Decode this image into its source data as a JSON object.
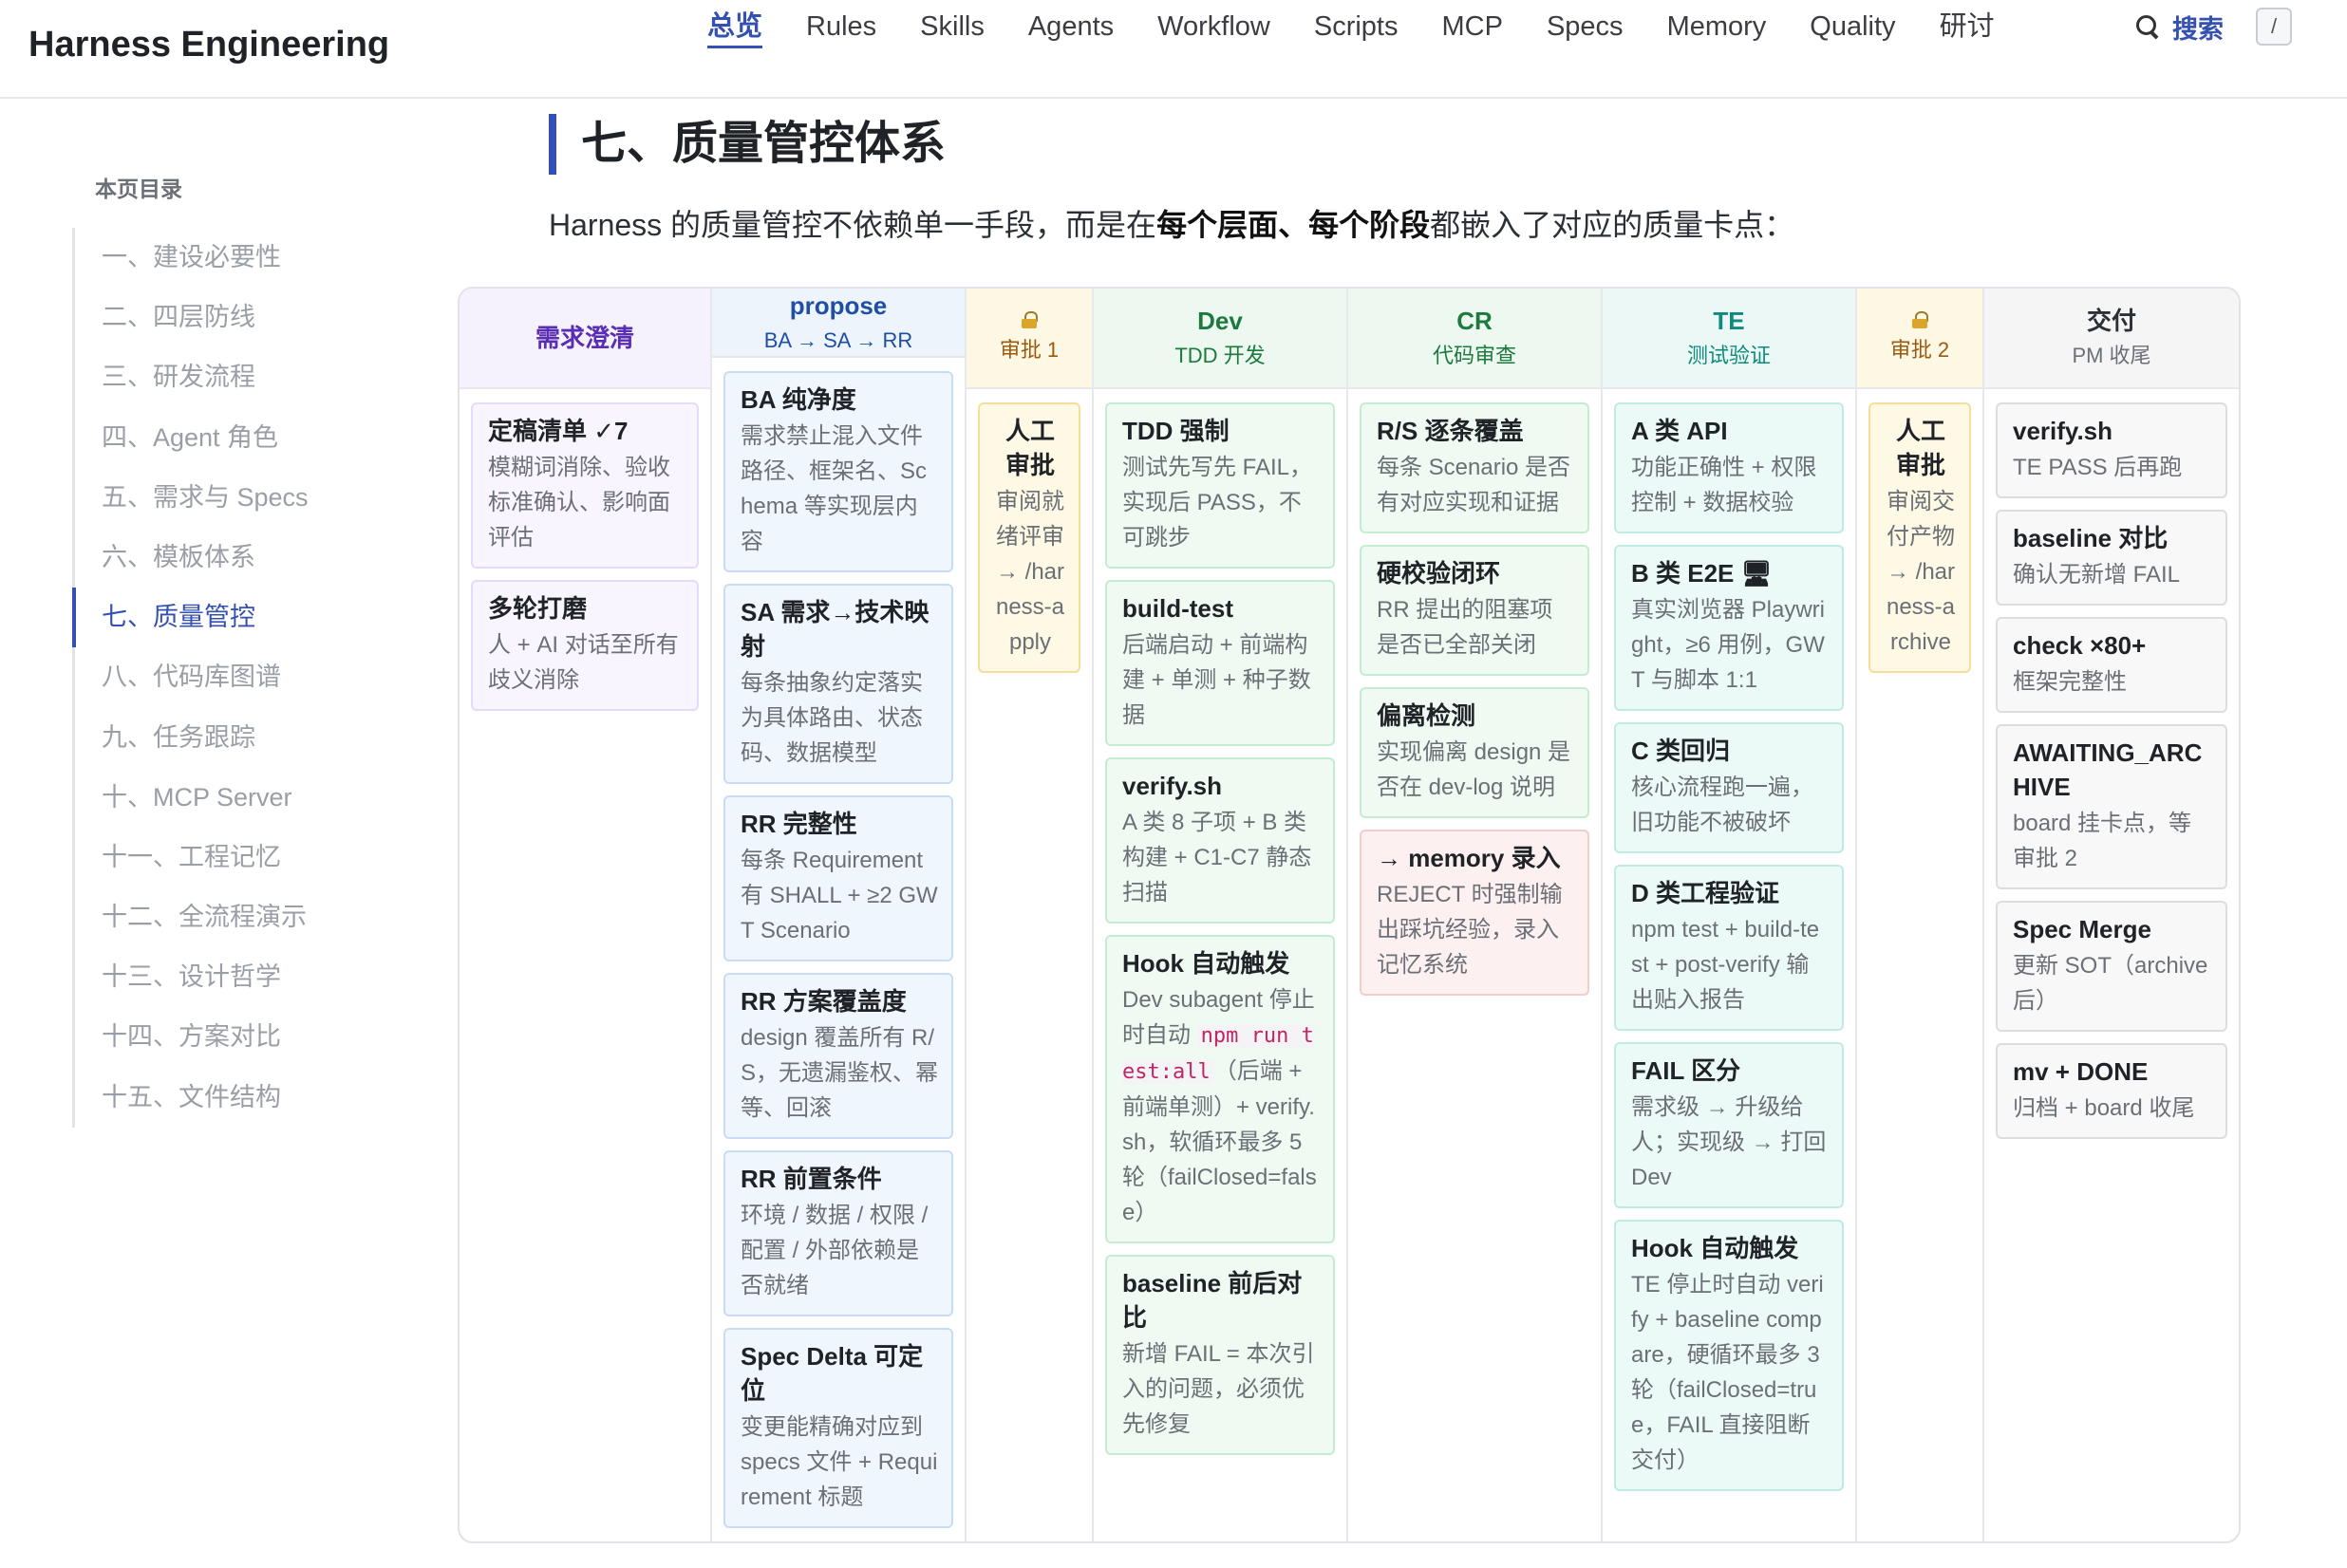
{
  "header": {
    "brand": "Harness Engineering",
    "nav": [
      "总览",
      "Rules",
      "Skills",
      "Agents",
      "Workflow",
      "Scripts",
      "MCP",
      "Specs",
      "Memory",
      "Quality",
      "研讨"
    ],
    "search_label": "搜索",
    "search_shortcut": "/"
  },
  "toc": {
    "title": "本页目录",
    "items": [
      "一、建设必要性",
      "二、四层防线",
      "三、研发流程",
      "四、Agent 角色",
      "五、需求与 Specs",
      "六、模板体系",
      "七、质量管控",
      "八、代码库图谱",
      "九、任务跟踪",
      "十、MCP Server",
      "十一、工程记忆",
      "十二、全流程演示",
      "十三、设计哲学",
      "十四、方案对比",
      "十五、文件结构"
    ],
    "active": "七、质量管控"
  },
  "main": {
    "heading": "七、质量管控体系",
    "intro_pre": "Harness 的质量管控不依赖单一手段，而是在",
    "intro_b1": "每个层面",
    "intro_sep": "、",
    "intro_b2": "每个阶段",
    "intro_post": "都嵌入了对应的质量卡点："
  },
  "columns": [
    {
      "title": "需求澄清",
      "sub": "",
      "cards": [
        {
          "title": "定稿清单 ✓7",
          "desc": "模糊词消除、验收标准确认、影响面评估"
        },
        {
          "title": "多轮打磨",
          "desc": "人 + AI 对话至所有歧义消除"
        }
      ]
    },
    {
      "title": "propose",
      "sub": "BA → SA → RR",
      "cards": [
        {
          "title": "BA 纯净度",
          "desc": "需求禁止混入文件路径、框架名、Schema 等实现层内容"
        },
        {
          "title": "SA 需求→技术映射",
          "desc": "每条抽象约定落实为具体路由、状态码、数据模型"
        },
        {
          "title": "RR 完整性",
          "desc": "每条 Requirement 有 SHALL + ≥2 GWT Scenario"
        },
        {
          "title": "RR 方案覆盖度",
          "desc": "design 覆盖所有 R/S，无遗漏鉴权、幂等、回滚"
        },
        {
          "title": "RR 前置条件",
          "desc": "环境 / 数据 / 权限 / 配置 / 外部依赖是否就绪"
        },
        {
          "title": "Spec Delta 可定位",
          "desc": "变更能精确对应到 specs 文件 + Requirement 标题"
        }
      ]
    },
    {
      "title": "",
      "sub": "审批 1",
      "cards": [
        {
          "title": "人工审批",
          "desc": "审阅就绪评审 → /harness-apply"
        }
      ]
    },
    {
      "title": "Dev",
      "sub": "TDD 开发",
      "cards": [
        {
          "title": "TDD 强制",
          "desc": "测试先写先 FAIL，实现后 PASS，不可跳步"
        },
        {
          "title": "build-test",
          "desc": "后端启动 + 前端构建 + 单测 + 种子数据"
        },
        {
          "title": "verify.sh",
          "desc": "A 类 8 子项 + B 类构建 + C1-C7 静态扫描"
        },
        {
          "title": "Hook 自动触发",
          "desc_pre": "Dev subagent 停止时自动 ",
          "code": "npm run test:all",
          "desc_post": "（后端 + 前端单测）+ verify.sh，软循环最多 5 轮（failClosed=false）"
        },
        {
          "title": "baseline 前后对比",
          "desc": "新增 FAIL = 本次引入的问题，必须优先修复"
        }
      ]
    },
    {
      "title": "CR",
      "sub": "代码审查",
      "cards": [
        {
          "title": "R/S 逐条覆盖",
          "desc": "每条 Scenario 是否有对应实现和证据"
        },
        {
          "title": "硬校验闭环",
          "desc": "RR 提出的阻塞项是否已全部关闭"
        },
        {
          "title": "偏离检测",
          "desc": "实现偏离 design 是否在 dev-log 说明"
        },
        {
          "title": "→ memory 录入",
          "desc": "REJECT 时强制输出踩坑经验，录入记忆系统"
        }
      ]
    },
    {
      "title": "TE",
      "sub": "测试验证",
      "cards": [
        {
          "title": "A 类 API",
          "desc": "功能正确性 + 权限控制 + 数据校验"
        },
        {
          "title": "B 类 E2E 🖥",
          "desc": "真实浏览器 Playwright，≥6 用例，GWT 与脚本 1:1"
        },
        {
          "title": "C 类回归",
          "desc": "核心流程跑一遍，旧功能不被破坏"
        },
        {
          "title": "D 类工程验证",
          "desc": "npm test + build-test + post-verify 输出贴入报告"
        },
        {
          "title": "FAIL 区分",
          "desc": "需求级 → 升级给人；实现级 → 打回 Dev"
        },
        {
          "title": "Hook 自动触发",
          "desc": "TE 停止时自动 verify + baseline compare，硬循环最多 3 轮（failClosed=true，FAIL 直接阻断交付）"
        }
      ]
    },
    {
      "title": "",
      "sub": "审批 2",
      "cards": [
        {
          "title": "人工审批",
          "desc": "审阅交付产物 → /harness-archive"
        }
      ]
    },
    {
      "title": "交付",
      "sub": "PM 收尾",
      "cards": [
        {
          "title": "verify.sh",
          "desc": "TE PASS 后再跑"
        },
        {
          "title": "baseline 对比",
          "desc": "确认无新增 FAIL"
        },
        {
          "title": "check ×80+",
          "desc": "框架完整性"
        },
        {
          "title": "AWAITING_ARCHIVE",
          "desc": "board 挂卡点，等审批 2"
        },
        {
          "title": "Spec Merge",
          "desc": "更新 SOT（archive 后）"
        },
        {
          "title": "mv + DONE",
          "desc": "归档 + board 收尾"
        }
      ]
    }
  ]
}
